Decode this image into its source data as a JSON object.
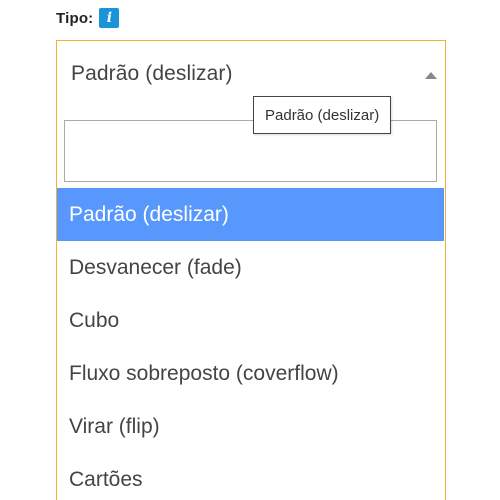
{
  "field": {
    "label": "Tipo:",
    "info_icon_glyph": "i",
    "info_icon_color": "#1b93d8"
  },
  "select": {
    "value": "Padrão (deslizar)",
    "border_color": "#f0b13c"
  },
  "tooltip": {
    "text": "Padrão (deslizar)"
  },
  "search": {
    "value": "",
    "placeholder": ""
  },
  "options": [
    {
      "label": "Padrão (deslizar)",
      "selected": true
    },
    {
      "label": "Desvanecer (fade)",
      "selected": false
    },
    {
      "label": "Cubo",
      "selected": false
    },
    {
      "label": "Fluxo sobreposto (coverflow)",
      "selected": false
    },
    {
      "label": "Virar (flip)",
      "selected": false
    },
    {
      "label": "Cartões",
      "selected": false
    }
  ],
  "colors": {
    "selected_bg": "#5897fb",
    "selected_text": "#ffffff"
  }
}
